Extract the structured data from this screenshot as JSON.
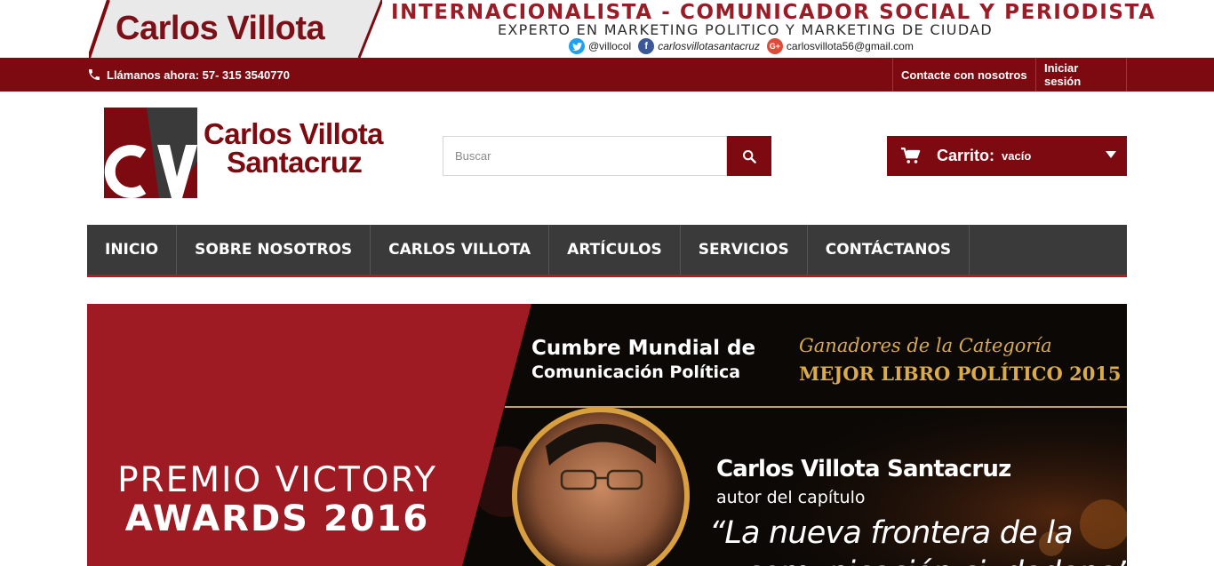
{
  "top_banner": {
    "brand_name": "Carlos Villota",
    "headline": "INTERNACIONALISTA - COMUNICADOR SOCIAL Y PERIODISTA",
    "subline": "EXPERTO EN MARKETING POLITICO Y MARKETING DE CIUDAD",
    "socials": [
      {
        "network": "twitter-icon",
        "handle": "@villocol"
      },
      {
        "network": "facebook-icon",
        "handle": "carlosvillotasantacruz"
      },
      {
        "network": "google-plus-icon",
        "handle": "carlosvillota56@gmail.com"
      }
    ]
  },
  "util_bar": {
    "phone_text": "Llámanos ahora: 57- 315 3540770",
    "contact_link": "Contacte con nosotros",
    "login_link": "Iniciar sesión"
  },
  "header": {
    "logo_monogram": "CV",
    "logo_line1": "Carlos Villota",
    "logo_line2": "Santacruz",
    "search_placeholder": "Buscar",
    "cart_title": "Carrito:",
    "cart_status": "vacío"
  },
  "nav": {
    "items": [
      "INICIO",
      "SOBRE NOSOTROS",
      "CARLOS VILLOTA",
      "ARTÍCULOS",
      "SERVICIOS",
      "CONTÁCTANOS"
    ]
  },
  "hero": {
    "premio": "PREMIO VICTORY",
    "awards": "AWARDS 2016",
    "cumbre_line1": "Cumbre Mundial de",
    "cumbre_line2": "Comunicación Política",
    "ganadores": "Ganadores de la Categoría",
    "mejor_libro": "MEJOR LIBRO POLÍTICO 2015",
    "person_name": "Carlos Villota Santacruz",
    "autor": "autor del capítulo",
    "quote_line1": "“La nueva frontera de la",
    "quote_line2": "comunicación ciudadana”"
  },
  "colors": {
    "brand_red": "#7d0a10",
    "nav_dark": "#3b3a3a",
    "nav_accent": "#b01c25",
    "hero_red": "#9e1b24",
    "gold": "#d9ab4a"
  }
}
